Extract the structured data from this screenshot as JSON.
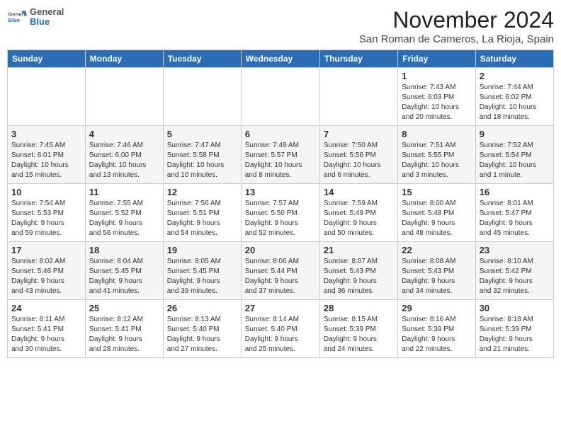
{
  "header": {
    "logo_line1": "General",
    "logo_line2": "Blue",
    "title": "November 2024",
    "location": "San Roman de Cameros, La Rioja, Spain"
  },
  "days_of_week": [
    "Sunday",
    "Monday",
    "Tuesday",
    "Wednesday",
    "Thursday",
    "Friday",
    "Saturday"
  ],
  "weeks": [
    [
      {
        "day": "",
        "info": ""
      },
      {
        "day": "",
        "info": ""
      },
      {
        "day": "",
        "info": ""
      },
      {
        "day": "",
        "info": ""
      },
      {
        "day": "",
        "info": ""
      },
      {
        "day": "1",
        "info": "Sunrise: 7:43 AM\nSunset: 6:03 PM\nDaylight: 10 hours\nand 20 minutes."
      },
      {
        "day": "2",
        "info": "Sunrise: 7:44 AM\nSunset: 6:02 PM\nDaylight: 10 hours\nand 18 minutes."
      }
    ],
    [
      {
        "day": "3",
        "info": "Sunrise: 7:45 AM\nSunset: 6:01 PM\nDaylight: 10 hours\nand 15 minutes."
      },
      {
        "day": "4",
        "info": "Sunrise: 7:46 AM\nSunset: 6:00 PM\nDaylight: 10 hours\nand 13 minutes."
      },
      {
        "day": "5",
        "info": "Sunrise: 7:47 AM\nSunset: 5:58 PM\nDaylight: 10 hours\nand 10 minutes."
      },
      {
        "day": "6",
        "info": "Sunrise: 7:49 AM\nSunset: 5:57 PM\nDaylight: 10 hours\nand 8 minutes."
      },
      {
        "day": "7",
        "info": "Sunrise: 7:50 AM\nSunset: 5:56 PM\nDaylight: 10 hours\nand 6 minutes."
      },
      {
        "day": "8",
        "info": "Sunrise: 7:51 AM\nSunset: 5:55 PM\nDaylight: 10 hours\nand 3 minutes."
      },
      {
        "day": "9",
        "info": "Sunrise: 7:52 AM\nSunset: 5:54 PM\nDaylight: 10 hours\nand 1 minute."
      }
    ],
    [
      {
        "day": "10",
        "info": "Sunrise: 7:54 AM\nSunset: 5:53 PM\nDaylight: 9 hours\nand 59 minutes."
      },
      {
        "day": "11",
        "info": "Sunrise: 7:55 AM\nSunset: 5:52 PM\nDaylight: 9 hours\nand 56 minutes."
      },
      {
        "day": "12",
        "info": "Sunrise: 7:56 AM\nSunset: 5:51 PM\nDaylight: 9 hours\nand 54 minutes."
      },
      {
        "day": "13",
        "info": "Sunrise: 7:57 AM\nSunset: 5:50 PM\nDaylight: 9 hours\nand 52 minutes."
      },
      {
        "day": "14",
        "info": "Sunrise: 7:59 AM\nSunset: 5:49 PM\nDaylight: 9 hours\nand 50 minutes."
      },
      {
        "day": "15",
        "info": "Sunrise: 8:00 AM\nSunset: 5:48 PM\nDaylight: 9 hours\nand 48 minutes."
      },
      {
        "day": "16",
        "info": "Sunrise: 8:01 AM\nSunset: 5:47 PM\nDaylight: 9 hours\nand 45 minutes."
      }
    ],
    [
      {
        "day": "17",
        "info": "Sunrise: 8:02 AM\nSunset: 5:46 PM\nDaylight: 9 hours\nand 43 minutes."
      },
      {
        "day": "18",
        "info": "Sunrise: 8:04 AM\nSunset: 5:45 PM\nDaylight: 9 hours\nand 41 minutes."
      },
      {
        "day": "19",
        "info": "Sunrise: 8:05 AM\nSunset: 5:45 PM\nDaylight: 9 hours\nand 39 minutes."
      },
      {
        "day": "20",
        "info": "Sunrise: 8:06 AM\nSunset: 5:44 PM\nDaylight: 9 hours\nand 37 minutes."
      },
      {
        "day": "21",
        "info": "Sunrise: 8:07 AM\nSunset: 5:43 PM\nDaylight: 9 hours\nand 36 minutes."
      },
      {
        "day": "22",
        "info": "Sunrise: 8:08 AM\nSunset: 5:43 PM\nDaylight: 9 hours\nand 34 minutes."
      },
      {
        "day": "23",
        "info": "Sunrise: 8:10 AM\nSunset: 5:42 PM\nDaylight: 9 hours\nand 32 minutes."
      }
    ],
    [
      {
        "day": "24",
        "info": "Sunrise: 8:11 AM\nSunset: 5:41 PM\nDaylight: 9 hours\nand 30 minutes."
      },
      {
        "day": "25",
        "info": "Sunrise: 8:12 AM\nSunset: 5:41 PM\nDaylight: 9 hours\nand 28 minutes."
      },
      {
        "day": "26",
        "info": "Sunrise: 8:13 AM\nSunset: 5:40 PM\nDaylight: 9 hours\nand 27 minutes."
      },
      {
        "day": "27",
        "info": "Sunrise: 8:14 AM\nSunset: 5:40 PM\nDaylight: 9 hours\nand 25 minutes."
      },
      {
        "day": "28",
        "info": "Sunrise: 8:15 AM\nSunset: 5:39 PM\nDaylight: 9 hours\nand 24 minutes."
      },
      {
        "day": "29",
        "info": "Sunrise: 8:16 AM\nSunset: 5:39 PM\nDaylight: 9 hours\nand 22 minutes."
      },
      {
        "day": "30",
        "info": "Sunrise: 8:18 AM\nSunset: 5:39 PM\nDaylight: 9 hours\nand 21 minutes."
      }
    ]
  ]
}
